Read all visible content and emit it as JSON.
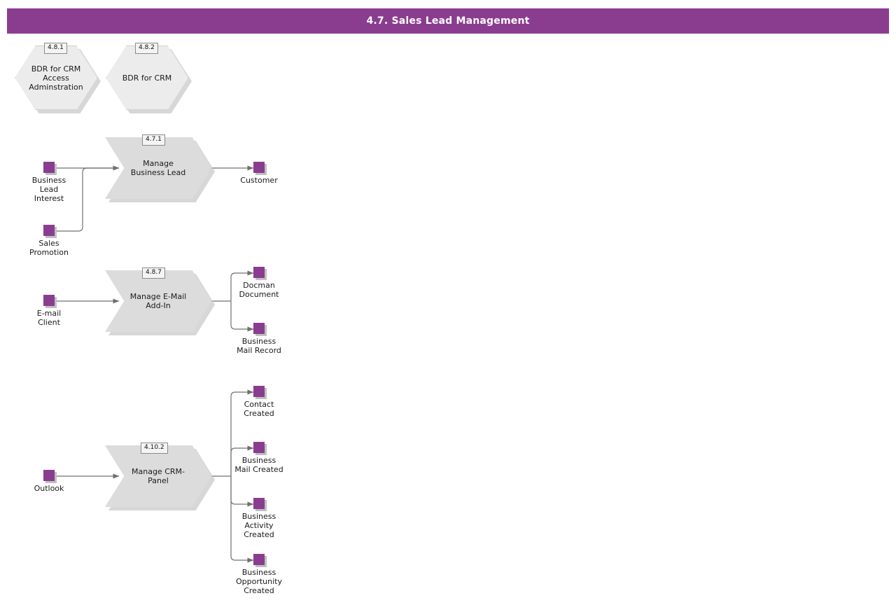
{
  "header": {
    "title": "4.7. Sales Lead Management",
    "background_color": "#8A3D8F",
    "text_color": "#FFFFFF"
  },
  "theme": {
    "object_color": "#8A3D8F",
    "process_fill": "#DCDCDC",
    "domain_fill": "#ECECEC",
    "connector_color": "#707070",
    "shadow_color": "#C9C9C9",
    "page_background": "#FFFFFF"
  },
  "diagram": {
    "type": "value-chain-process-diagram",
    "domains": [
      {
        "id": "4.8.1",
        "label": "BDR for CRM\nAccess\nAdminstration"
      },
      {
        "id": "4.8.2",
        "label": "BDR for CRM"
      }
    ],
    "rows": [
      {
        "name": "manage-business-lead",
        "process": {
          "id": "4.7.1",
          "label": "Manage\nBusiness Lead"
        },
        "inputs": [
          {
            "label": "Business\nLead\nInterest"
          },
          {
            "label": "Sales\nPromotion"
          }
        ],
        "outputs": [
          {
            "label": "Customer"
          }
        ]
      },
      {
        "name": "manage-email-add-in",
        "process": {
          "id": "4.8.7",
          "label": "Manage E-Mail\nAdd-In"
        },
        "inputs": [
          {
            "label": "E-mail\nClient"
          }
        ],
        "outputs": [
          {
            "label": "Docman\nDocument"
          },
          {
            "label": "Business\nMail Record"
          }
        ]
      },
      {
        "name": "manage-crm-panel",
        "process": {
          "id": "4.10.2",
          "label": "Manage CRM-\nPanel"
        },
        "inputs": [
          {
            "label": "Outlook"
          }
        ],
        "outputs": [
          {
            "label": "Contact\nCreated"
          },
          {
            "label": "Business\nMail Created"
          },
          {
            "label": "Business\nActivity\nCreated"
          },
          {
            "label": "Business\nOpportunity\nCreated"
          }
        ]
      }
    ]
  }
}
